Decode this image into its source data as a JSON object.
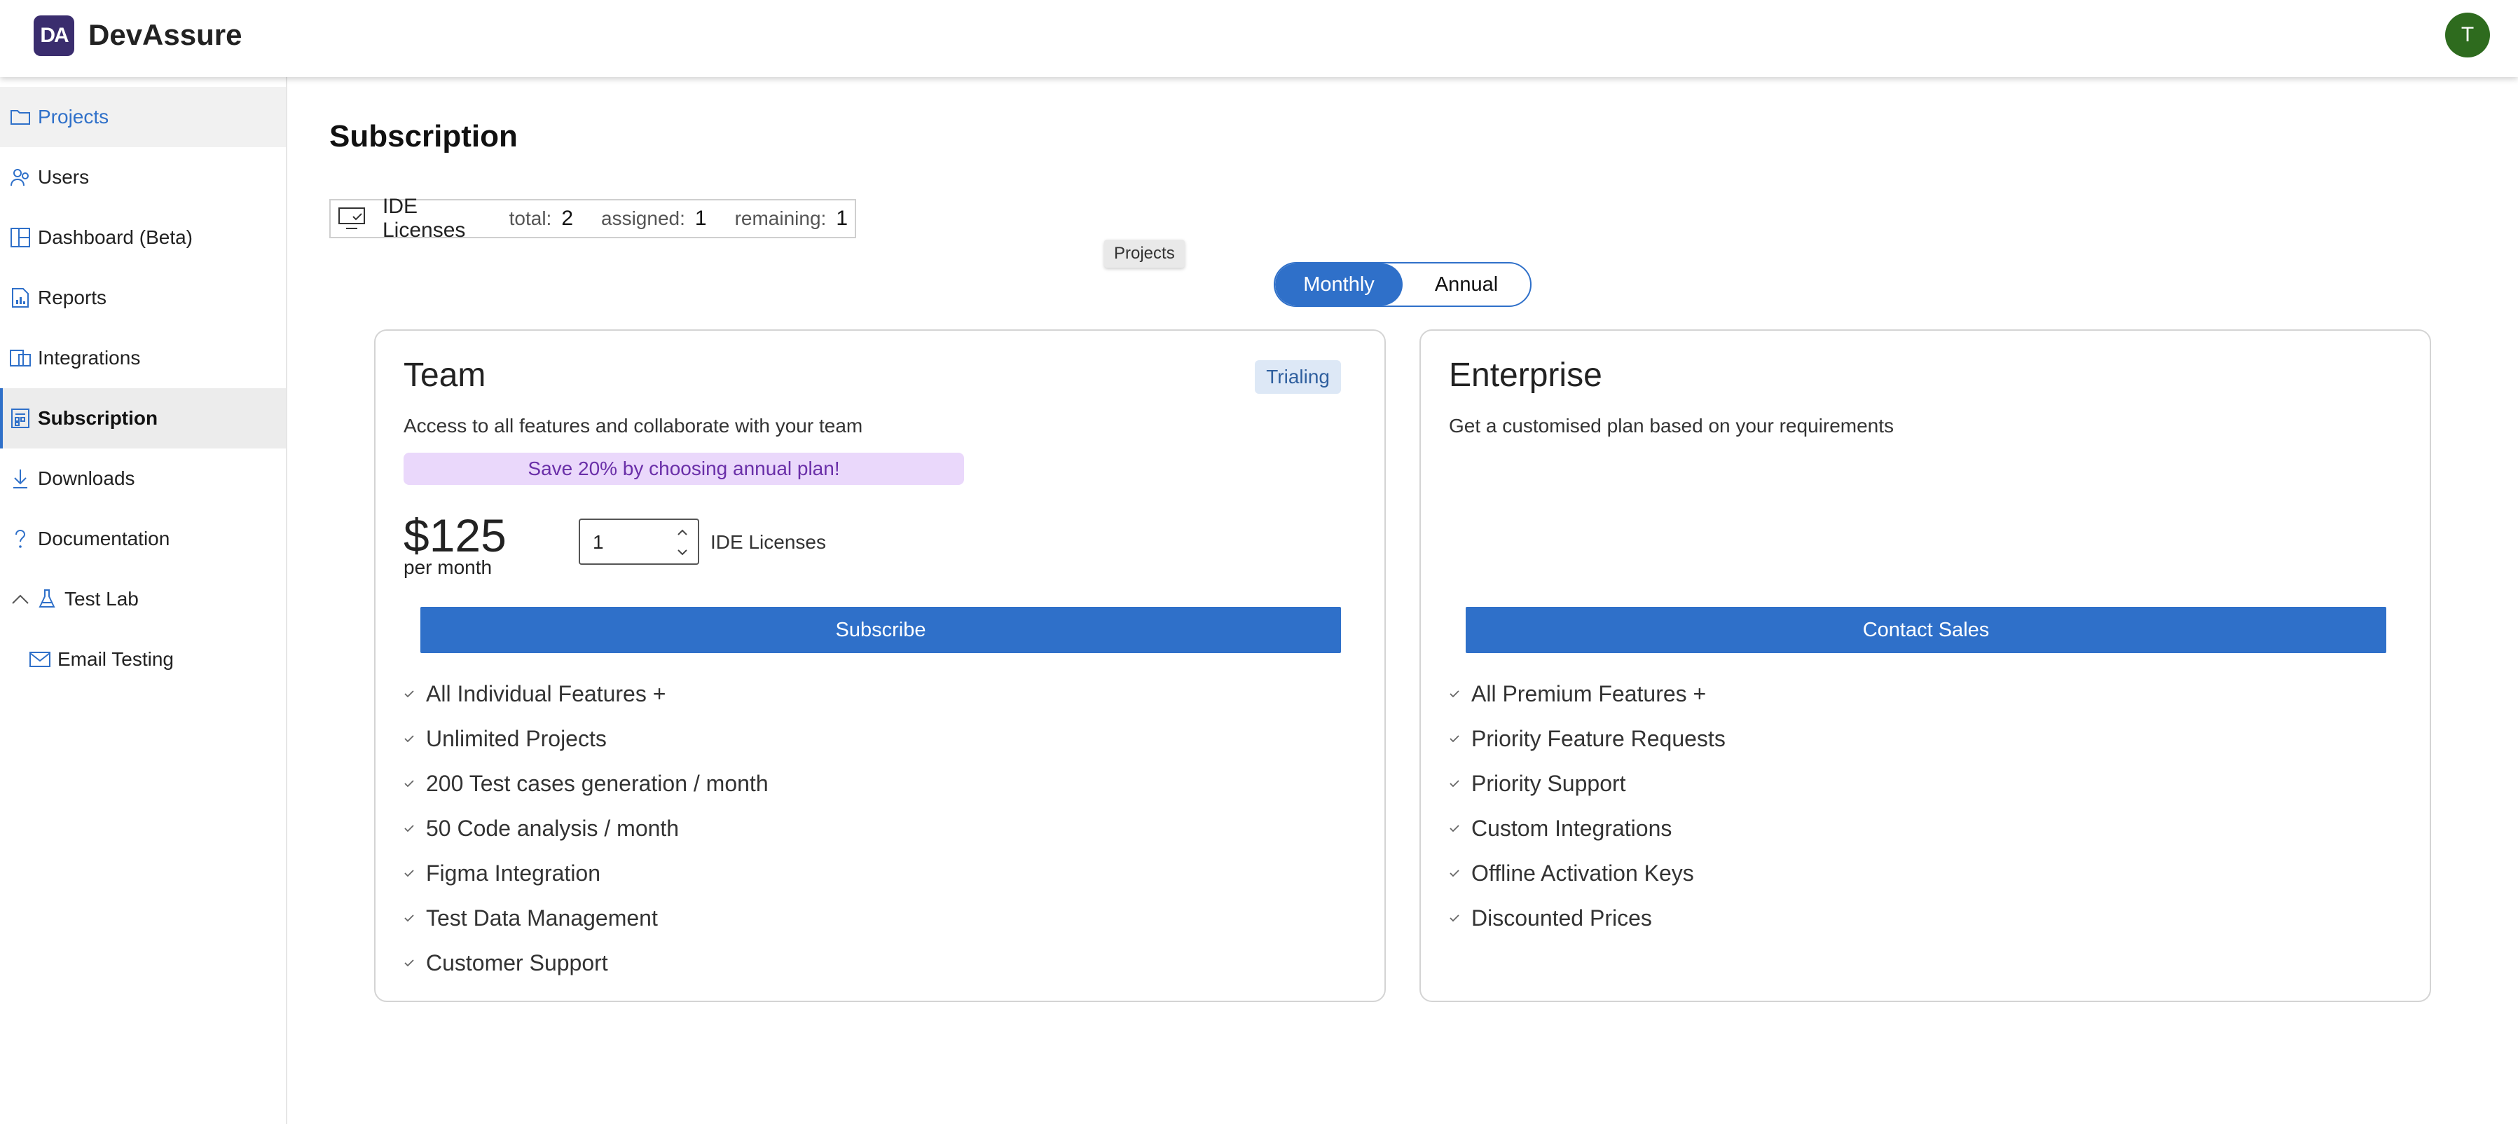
{
  "app": {
    "brand": "DevAssure",
    "logo_text": "DA",
    "avatar_initial": "T"
  },
  "sidebar": {
    "items": [
      {
        "label": "Projects",
        "icon": "folder-icon"
      },
      {
        "label": "Users",
        "icon": "users-icon"
      },
      {
        "label": "Dashboard (Beta)",
        "icon": "dashboard-icon"
      },
      {
        "label": "Reports",
        "icon": "report-icon"
      },
      {
        "label": "Integrations",
        "icon": "integrations-icon"
      },
      {
        "label": "Subscription",
        "icon": "subscription-icon"
      },
      {
        "label": "Downloads",
        "icon": "download-icon"
      },
      {
        "label": "Documentation",
        "icon": "question-icon"
      },
      {
        "label": "Test Lab",
        "icon": "flask-icon"
      },
      {
        "label": "Email Testing",
        "icon": "envelope-icon"
      }
    ]
  },
  "page": {
    "title": "Subscription"
  },
  "licenses": {
    "title": "IDE Licenses",
    "total_label": "total:",
    "total": "2",
    "assigned_label": "assigned:",
    "assigned": "1",
    "remaining_label": "remaining:",
    "remaining": "1"
  },
  "tooltip": "Projects",
  "billing_toggle": {
    "monthly": "Monthly",
    "annual": "Annual",
    "selected": "Monthly"
  },
  "plans": {
    "team": {
      "title": "Team",
      "badge": "Trialing",
      "description": "Access to all features and collaborate with your team",
      "promo": "Save 20% by choosing annual plan!",
      "price": "$125",
      "period": "per month",
      "quantity": "1",
      "quantity_label": "IDE Licenses",
      "button": "Subscribe",
      "features": [
        "All Individual Features +",
        "Unlimited Projects",
        "200 Test cases generation / month",
        "50 Code analysis / month",
        "Figma Integration",
        "Test Data Management",
        "Customer Support"
      ]
    },
    "enterprise": {
      "title": "Enterprise",
      "description": "Get a customised plan based on your requirements",
      "button": "Contact Sales",
      "features": [
        "All Premium Features +",
        "Priority Feature Requests",
        "Priority Support",
        "Custom Integrations",
        "Offline Activation Keys",
        "Discounted Prices"
      ]
    }
  },
  "colors": {
    "accent": "#2f70c9",
    "brand_logo": "#3a2d6e",
    "avatar": "#2e6b1e",
    "promo_bg": "#ead8fb",
    "promo_text": "#6a2fa8"
  }
}
